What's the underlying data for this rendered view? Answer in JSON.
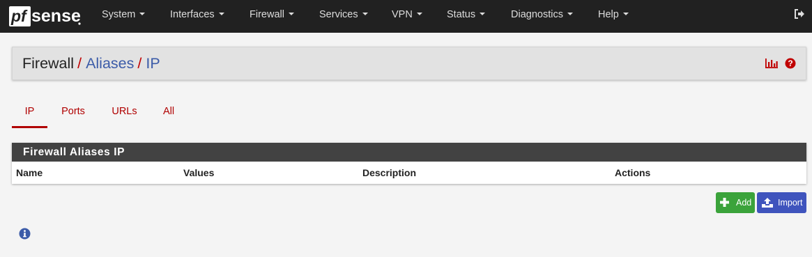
{
  "brand": {
    "logo_text": "pfsense"
  },
  "nav": {
    "items": [
      {
        "label": "System"
      },
      {
        "label": "Interfaces"
      },
      {
        "label": "Firewall"
      },
      {
        "label": "Services"
      },
      {
        "label": "VPN"
      },
      {
        "label": "Status"
      },
      {
        "label": "Diagnostics"
      },
      {
        "label": "Help"
      }
    ],
    "logout_icon": "sign-out-icon"
  },
  "breadcrumb": {
    "root": "Firewall",
    "items": [
      "Aliases",
      "IP"
    ],
    "separator": "/",
    "icons": [
      "bar-chart-icon",
      "question-circle-icon"
    ]
  },
  "tabs": [
    {
      "label": "IP",
      "active": true
    },
    {
      "label": "Ports",
      "active": false
    },
    {
      "label": "URLs",
      "active": false
    },
    {
      "label": "All",
      "active": false
    }
  ],
  "table": {
    "title": "Firewall Aliases IP",
    "columns": [
      "Name",
      "Values",
      "Description",
      "Actions"
    ],
    "rows": []
  },
  "buttons": {
    "add_label": "Add",
    "import_label": "Import"
  },
  "colors": {
    "navbar": "#212121",
    "accent_red": "#b00000",
    "link_blue": "#3b5ba8",
    "add_green": "#3ba33b",
    "import_blue": "#3f54bd"
  },
  "info_icon": "info-circle-icon"
}
